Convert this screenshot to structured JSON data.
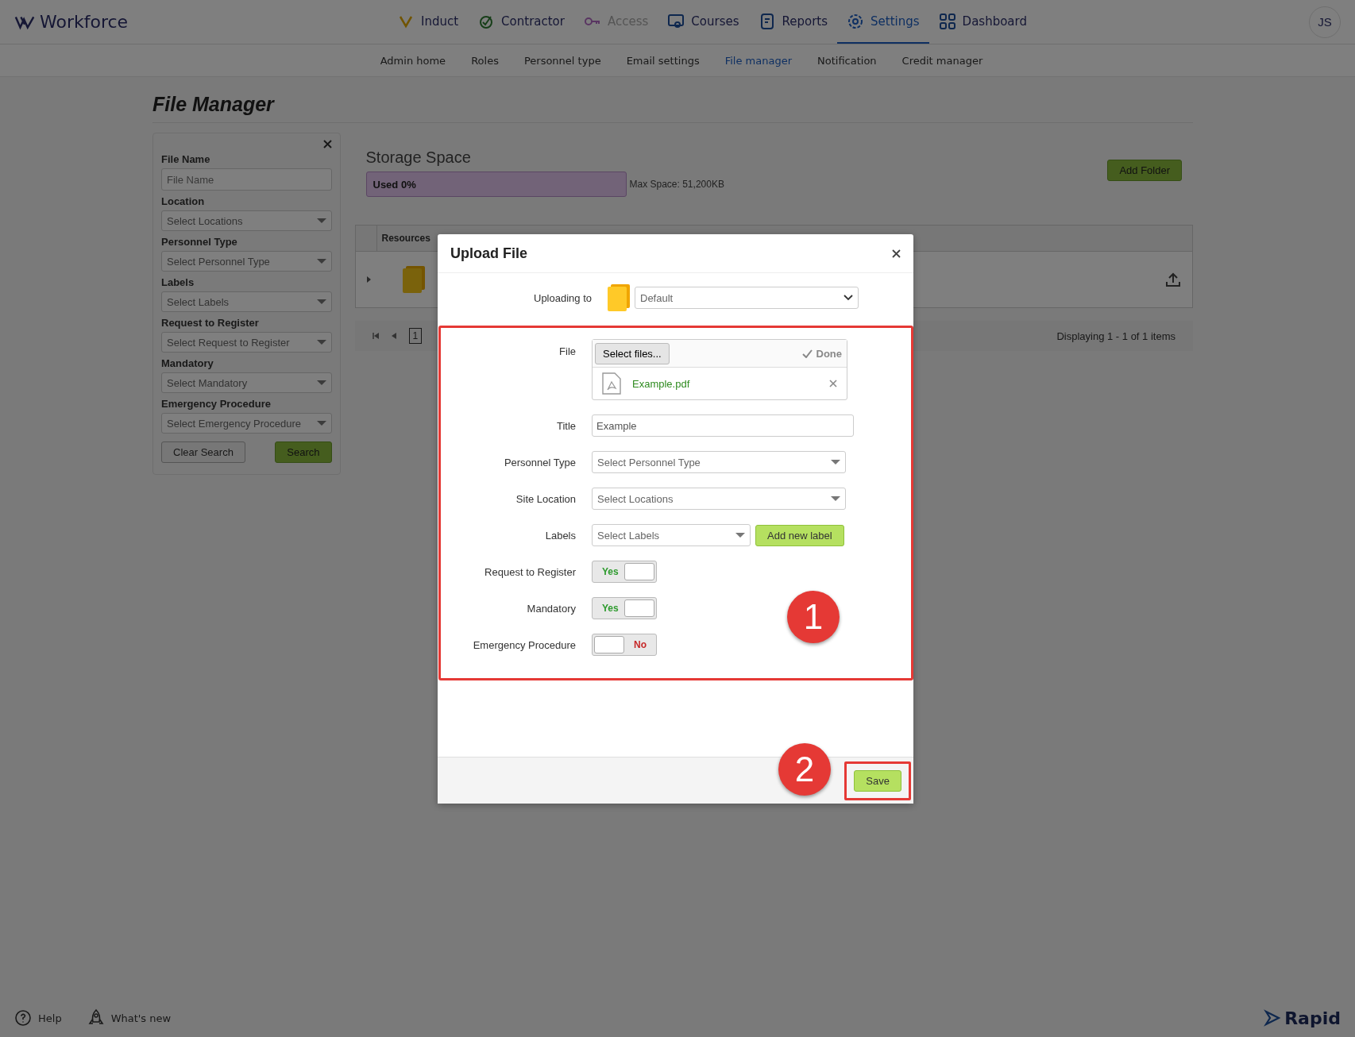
{
  "app": {
    "logo": "Workforce",
    "avatar": "JS"
  },
  "nav": [
    {
      "label": "Induct",
      "selected": false,
      "disabled": false
    },
    {
      "label": "Contractor",
      "selected": false,
      "disabled": false
    },
    {
      "label": "Access",
      "selected": false,
      "disabled": true
    },
    {
      "label": "Courses",
      "selected": false,
      "disabled": false
    },
    {
      "label": "Reports",
      "selected": false,
      "disabled": false
    },
    {
      "label": "Settings",
      "selected": true,
      "disabled": false
    },
    {
      "label": "Dashboard",
      "selected": false,
      "disabled": false
    }
  ],
  "subnav": [
    {
      "label": "Admin home",
      "selected": false
    },
    {
      "label": "Roles",
      "selected": false
    },
    {
      "label": "Personnel type",
      "selected": false
    },
    {
      "label": "Email settings",
      "selected": false
    },
    {
      "label": "File manager",
      "selected": true
    },
    {
      "label": "Notification",
      "selected": false
    },
    {
      "label": "Credit manager",
      "selected": false
    }
  ],
  "page_title": "File Manager",
  "filter_panel": {
    "fields": [
      {
        "label": "File Name",
        "kind": "text",
        "placeholder": "File Name"
      },
      {
        "label": "Location",
        "kind": "select",
        "placeholder": "Select Locations"
      },
      {
        "label": "Personnel Type",
        "kind": "select",
        "placeholder": "Select Personnel Type"
      },
      {
        "label": "Labels",
        "kind": "select",
        "placeholder": "Select Labels"
      },
      {
        "label": "Request to Register",
        "kind": "select",
        "placeholder": "Select Request to Register"
      },
      {
        "label": "Mandatory",
        "kind": "select",
        "placeholder": "Select Mandatory"
      },
      {
        "label": "Emergency Procedure",
        "kind": "select",
        "placeholder": "Select Emergency Procedure"
      }
    ],
    "clear_button": "Clear Search",
    "search_button": "Search"
  },
  "storage": {
    "title": "Storage Space",
    "used": "Used 0%",
    "max_space": "Max Space: 51,200KB",
    "add_button": "Add Folder"
  },
  "table": {
    "columns": [
      "Resources"
    ]
  },
  "pager": {
    "page": "1",
    "status": "Displaying 1 - 1 of 1 items"
  },
  "modal": {
    "title": "Upload File",
    "uploading_to": {
      "label": "Uploading to",
      "value": "Default"
    },
    "file": {
      "label": "File",
      "select_button": "Select files...",
      "done": "Done",
      "file_name": "Example.pdf"
    },
    "title_field": {
      "label": "Title",
      "value": "Example"
    },
    "selects": [
      {
        "label": "Personnel Type",
        "placeholder": "Select Personnel Type"
      },
      {
        "label": "Site Location",
        "placeholder": "Select Locations"
      }
    ],
    "labels": {
      "label": "Labels",
      "placeholder": "Select Labels",
      "add_button": "Add new label"
    },
    "toggles": [
      {
        "label": "Request to Register",
        "on": true,
        "text": "Yes"
      },
      {
        "label": "Mandatory",
        "on": true,
        "text": "Yes"
      },
      {
        "label": "Emergency Procedure",
        "on": false,
        "text": "No"
      }
    ],
    "save_button": "Save"
  },
  "callouts": [
    "1",
    "2"
  ],
  "footer": {
    "help": "Help",
    "whats_new": "What's new",
    "brand": "Rapid"
  }
}
